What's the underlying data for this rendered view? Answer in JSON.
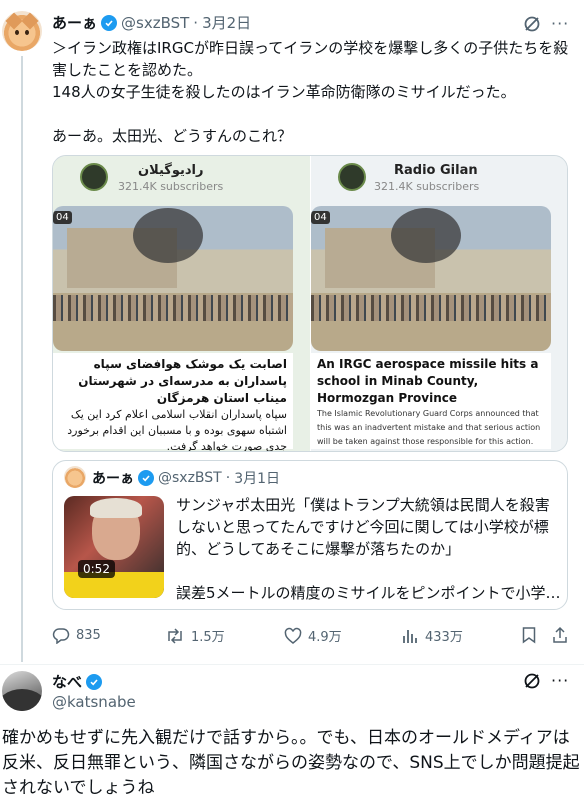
{
  "tweet": {
    "author_name": "あーぁ",
    "handle": "@sxzBST",
    "separator": "·",
    "date": "3月2日",
    "body": "＞イラン政権はIRGCが昨日誤ってイランの学校を爆撃し多くの子供たちを殺害したことを認めた。\n148人の女子生徒を殺したのはイラン革命防衛隊のミサイルだった。\n\nあーあ。太田光、どうすんのこれ？",
    "media": {
      "left": {
        "channel_name": "رادیوگیلان",
        "subscribers": "321.4K subscribers",
        "timestamp": "04",
        "caption_headline": "اصابت یک موشک هوافضای سپاه پاسداران به مدرسه‌ای در شهرستان میناب استان هرمزگان",
        "caption_body": "سپاه پاسداران انقلاب اسلامی اعلام کرد این یک اشتباه سهوی بوده و با مسببان این اقدام برخورد جدی صورت خواهد گرفت."
      },
      "right": {
        "channel_name": "Radio Gilan",
        "subscribers": "321.4K subscribers",
        "timestamp": "04",
        "caption_headline": "An IRGC aerospace missile hits a school in Minab County, Hormozgan Province",
        "caption_body": "The Islamic Revolutionary Guard Corps announced that this was an inadvertent mistake and that serious action will be taken against those responsible for this action."
      }
    },
    "quote": {
      "author_name": "あーぁ",
      "handle": "@sxzBST",
      "separator": "·",
      "date": "3月1日",
      "video_duration": "0:52",
      "text_1": "サンジャポ太田光「僕はトランプ大統領は民間人を殺害しないと思ってたんですけど今回に関しては小学校が標的、どうしてあそこに爆撃が落ちたのか」",
      "text_2": "誤差5メートルの精度のミサイルをピンポイントで小学…"
    },
    "actions": {
      "replies": "835",
      "reposts": "1.5万",
      "likes": "4.9万",
      "views": "433万"
    }
  },
  "reply": {
    "author_name": "なべ",
    "handle": "@katsnabe",
    "body": "確かめもせずに先入観だけで話すから。。でも、日本のオールドメディアは反米、反日無罪という、隣国さながらの姿勢なので、SNS上でしか問題提起されないでしょうね"
  },
  "colors": {
    "verified": "#1d9bf0",
    "secondary_text": "#536471",
    "border": "#cfd9de"
  }
}
